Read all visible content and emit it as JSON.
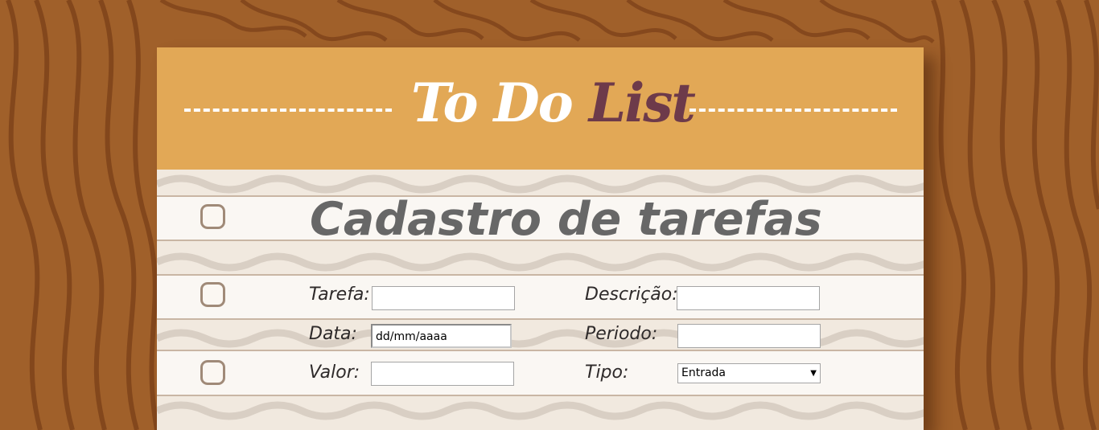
{
  "header": {
    "brand_part1": "To Do",
    "brand_part2": "List"
  },
  "title": "Cadastro de tarefas",
  "form": {
    "tarefa_label": "Tarefa:",
    "descricao_label": "Descrição:",
    "data_label": "Data:",
    "data_value": "dd/mm/aaaa",
    "periodo_label": "Periodo:",
    "valor_label": "Valor:",
    "tipo_label": "Tipo:",
    "tipo_selected": "Entrada"
  },
  "colors": {
    "wood": "#a0602a",
    "header": "#e2a856",
    "brand_accent": "#6d3a4a",
    "paper": "#f1e9df"
  }
}
